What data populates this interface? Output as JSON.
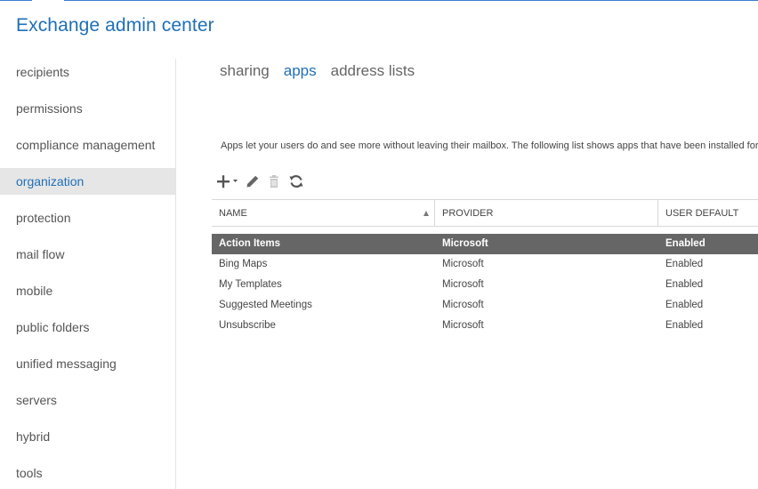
{
  "app": {
    "title": "Exchange admin center"
  },
  "sidebar": {
    "items": [
      {
        "label": "recipients"
      },
      {
        "label": "permissions"
      },
      {
        "label": "compliance management"
      },
      {
        "label": "organization",
        "active": true
      },
      {
        "label": "protection"
      },
      {
        "label": "mail flow"
      },
      {
        "label": "mobile"
      },
      {
        "label": "public folders"
      },
      {
        "label": "unified messaging"
      },
      {
        "label": "servers"
      },
      {
        "label": "hybrid"
      },
      {
        "label": "tools"
      }
    ]
  },
  "tabs": [
    {
      "label": "sharing"
    },
    {
      "label": "apps",
      "active": true
    },
    {
      "label": "address lists"
    }
  ],
  "main": {
    "description": "Apps let your users do and see more without leaving their mailbox. The following list shows apps that have been installed for your organization."
  },
  "toolbar": {
    "icons": [
      "add-icon",
      "edit-icon",
      "delete-icon",
      "refresh-icon"
    ]
  },
  "grid": {
    "columns": {
      "name": "NAME",
      "provider": "PROVIDER",
      "user_default": "USER DEFAULT"
    },
    "sort": {
      "column": "name",
      "direction": "ascending"
    },
    "rows": [
      {
        "name": "Action Items",
        "provider": "Microsoft",
        "user_default": "Enabled",
        "selected": true
      },
      {
        "name": "Bing Maps",
        "provider": "Microsoft",
        "user_default": "Enabled"
      },
      {
        "name": "My Templates",
        "provider": "Microsoft",
        "user_default": "Enabled"
      },
      {
        "name": "Suggested Meetings",
        "provider": "Microsoft",
        "user_default": "Enabled"
      },
      {
        "name": "Unsubscribe",
        "provider": "Microsoft",
        "user_default": "Enabled"
      }
    ]
  },
  "colors": {
    "accent": "#1f6fb7",
    "selected_row": "#666666",
    "active_nav_bg": "#e6e6e6"
  }
}
